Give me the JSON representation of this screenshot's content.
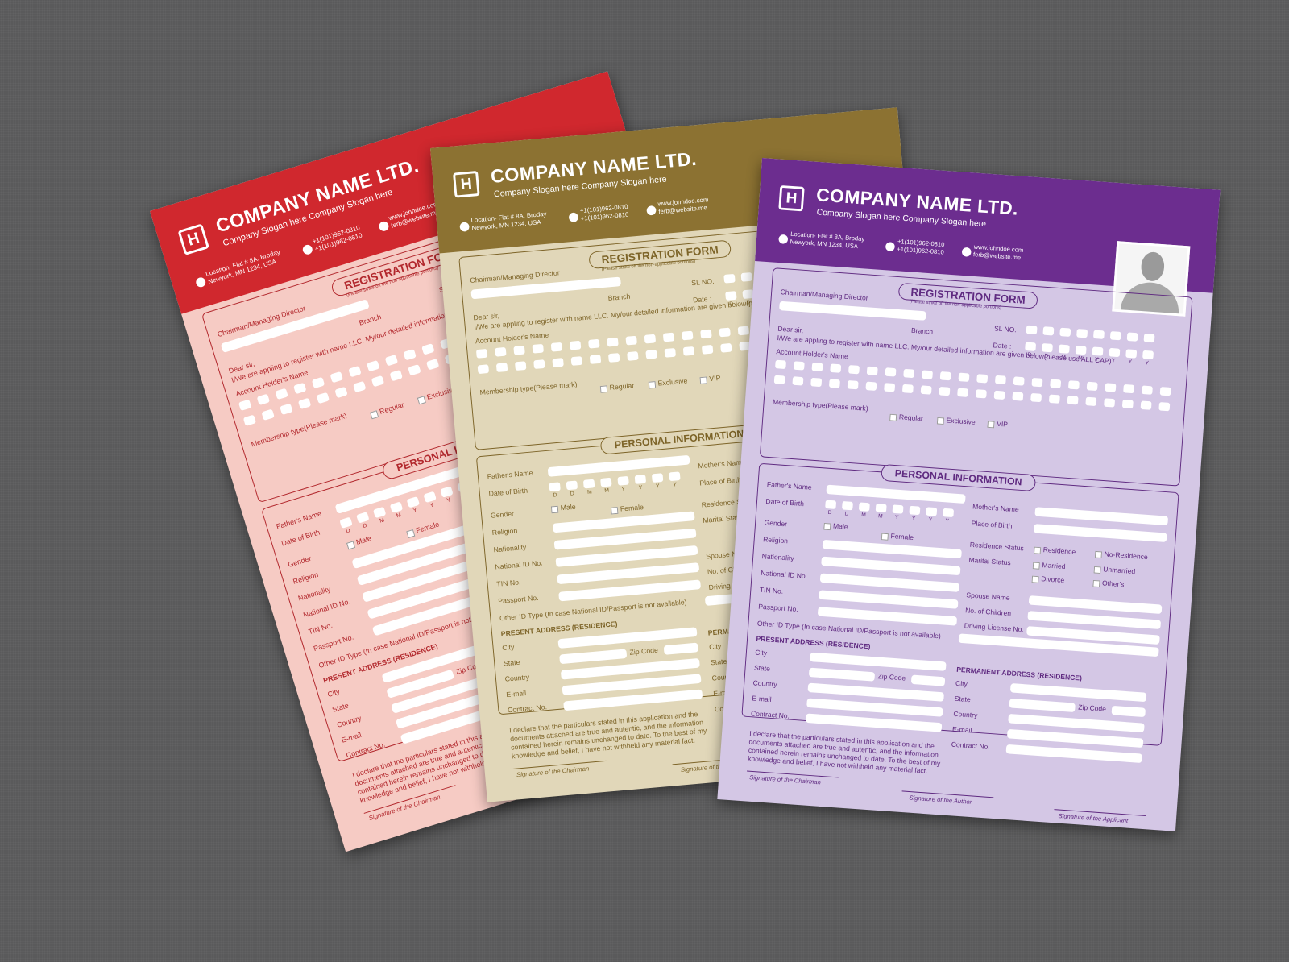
{
  "company": {
    "name": "COMPANY NAME LTD.",
    "slogan": "Company Slogan here Company Slogan here",
    "location": "Location- Flat # 8A, Broday\nNewyork, MN 1234, USA",
    "phone": "+1(101)962-0810\n+1(101)962-0810",
    "web": "www.johndoe.com\nferb@website.me",
    "logo_letter": "H"
  },
  "form": {
    "title": "REGISTRATION FORM",
    "subnote": "(Please strike off the non-applicable portions)",
    "chairman": "Chairman/Managing Director",
    "branch": "Branch",
    "sl_no": "SL NO.",
    "date": "Date :",
    "date_letters": [
      "D",
      "D",
      "M",
      "M",
      "Y",
      "Y",
      "Y",
      "Y"
    ],
    "dear": "Dear sir,",
    "intro": "I/We are appling to register with name LLC. My/our detailed information are given below(please use ALL CAP)",
    "account_holder": "Account Holder's Name",
    "membership": "Membership type(Please mark)",
    "memberships": [
      "Regular",
      "Exclusive",
      "VIP"
    ],
    "personal_title": "PERSONAL INFORMATION",
    "fathers_name": "Father's Name",
    "mothers_name": "Mother's Name",
    "dob": "Date of Birth",
    "place_of_birth": "Place of Birth",
    "gender": "Gender",
    "male": "Male",
    "female": "Female",
    "religion": "Religion",
    "residence_status": "Residence Status",
    "residence": "Residence",
    "no_residence": "No-Residence",
    "nationality": "Nationality",
    "marital_status": "Marital Status",
    "married": "Married",
    "unmarried": "Unmarried",
    "divorce": "Divorce",
    "others": "Other's",
    "national_id": "National ID No.",
    "spouse": "Spouse Name",
    "tin": "TIN No.",
    "children": "No. of Children",
    "passport": "Passport No.",
    "driving": "Driving License No.",
    "other_id": "Other ID Type (In case National ID/Passport is not available)",
    "present_address": "PRESENT ADDRESS (RESIDENCE)",
    "permanent_address": "PERMANENT ADDRESS (RESIDENCE)",
    "city": "City",
    "state": "State",
    "zip": "Zip Code",
    "country": "Country",
    "email": "E-mail",
    "contract": "Contract No.",
    "declaration": "I declare that the particulars stated in this application and the documents attached are true and autentic, and the information contained herein remains unchanged to date. To the best of my knowledge and belief, I have not withheld any material fact.",
    "sig_chairman": "Signature of the Chairman",
    "sig_author": "Signature of the Author",
    "sig_applicant": "Signature of the Applicant"
  },
  "colors": {
    "background": "#5a5a5b",
    "red_header": "#d0282e",
    "red_paper": "#f6cbc4",
    "red_ink": "#b2282d",
    "gold_header": "#8c7232",
    "gold_paper": "#e1d7b9",
    "gold_ink": "#7d6428",
    "purple_header": "#6c2d8f",
    "purple_paper": "#d4c7e5",
    "purple_ink": "#5f2a80"
  },
  "sheets": [
    {
      "variant": "red",
      "icons": [
        "user-avatar-icon",
        "location-pin-icon",
        "phone-icon",
        "globe-icon"
      ]
    },
    {
      "variant": "gold",
      "icons": [
        "user-avatar-icon",
        "location-pin-icon",
        "phone-icon",
        "globe-icon"
      ]
    },
    {
      "variant": "purple",
      "icons": [
        "user-avatar-icon",
        "location-pin-icon",
        "phone-icon",
        "globe-icon"
      ]
    }
  ]
}
